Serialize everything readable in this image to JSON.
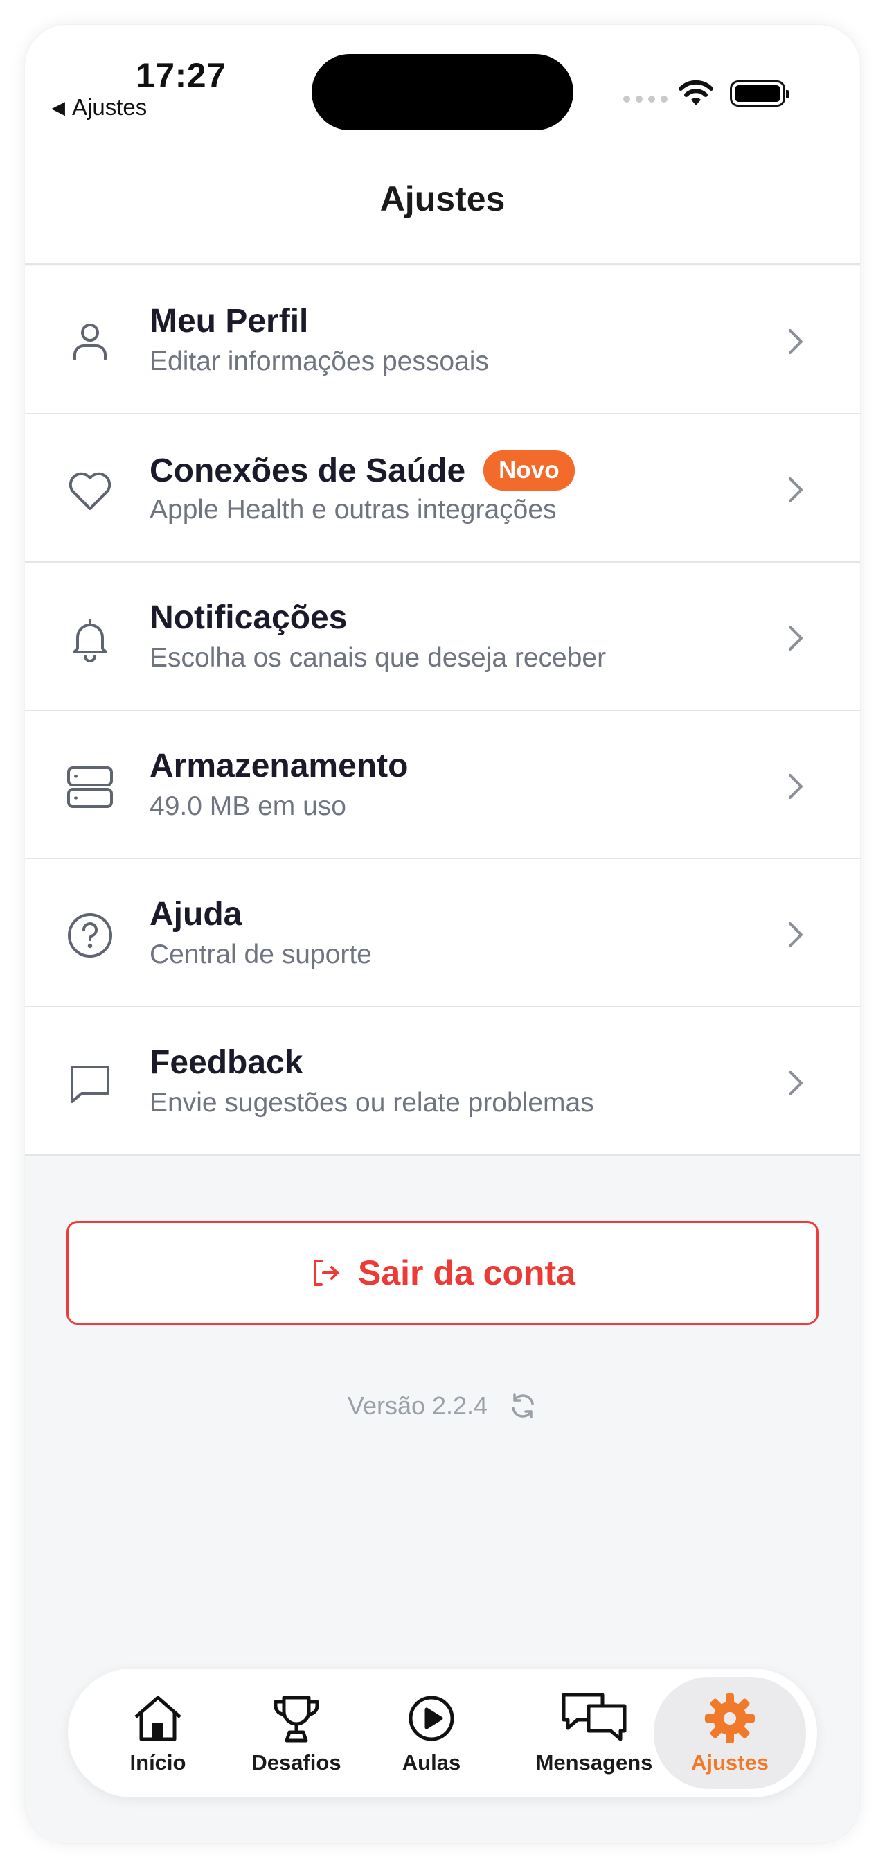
{
  "status_bar": {
    "time": "17:27",
    "back_label": "Ajustes"
  },
  "header": {
    "title": "Ajustes"
  },
  "menu": {
    "items": [
      {
        "title": "Meu Perfil",
        "subtitle": "Editar informações pessoais",
        "icon": "user-icon"
      },
      {
        "title": "Conexões de Saúde",
        "subtitle": "Apple Health e outras integrações",
        "badge": "Novo",
        "icon": "heart-icon"
      },
      {
        "title": "Notificações",
        "subtitle": "Escolha os canais que deseja receber",
        "icon": "bell-icon"
      },
      {
        "title": "Armazenamento",
        "subtitle": "49.0 MB em uso",
        "icon": "storage-icon"
      },
      {
        "title": "Ajuda",
        "subtitle": "Central de suporte",
        "icon": "help-icon"
      },
      {
        "title": "Feedback",
        "subtitle": "Envie sugestões ou relate problemas",
        "icon": "message-icon"
      }
    ]
  },
  "logout": {
    "label": "Sair da conta"
  },
  "version": {
    "label": "Versão 2.2.4"
  },
  "tabbar": {
    "tabs": [
      {
        "label": "Início",
        "icon": "home-icon"
      },
      {
        "label": "Desafios",
        "icon": "trophy-icon"
      },
      {
        "label": "Aulas",
        "icon": "play-icon"
      },
      {
        "label": "Mensagens",
        "icon": "chat-icon"
      },
      {
        "label": "Ajustes",
        "icon": "gear-icon",
        "active": true
      }
    ]
  },
  "colors": {
    "accent": "#f07a2a",
    "danger": "#ee3a35",
    "badge": "#f26b2a"
  }
}
